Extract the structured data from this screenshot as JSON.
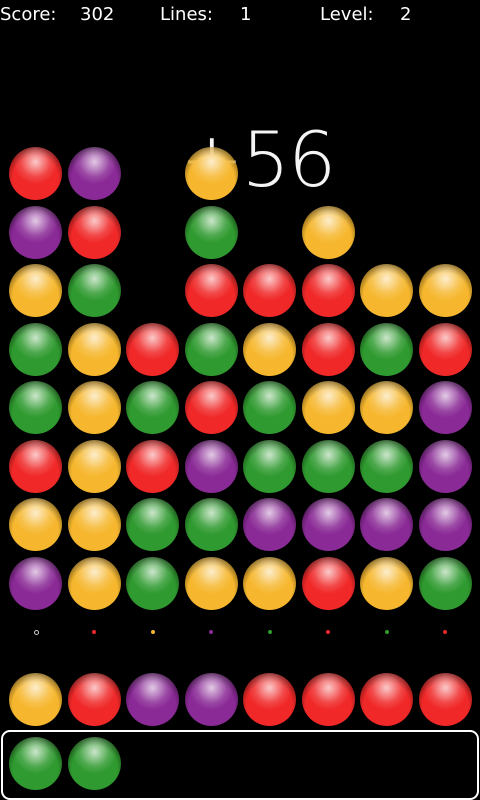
{
  "hud": {
    "score_label": "Score:",
    "score_value": "302",
    "lines_label": "Lines:",
    "lines_value": "1",
    "level_label": "Level:",
    "level_value": "2"
  },
  "popup": {
    "text": "+56"
  },
  "colors": {
    "red": "#f02828",
    "purple": "#8a2a96",
    "yellow": "#f6b72e",
    "green": "#2f9a2f"
  },
  "grid": [
    [
      "red",
      "purple",
      "",
      "",
      "",
      "",
      "",
      ""
    ],
    [
      "purple",
      "red",
      "",
      "green",
      "",
      "yellow",
      "",
      ""
    ],
    [
      "yellow",
      "green",
      "",
      "red",
      "red",
      "red",
      "yellow",
      "yellow"
    ],
    [
      "green",
      "yellow",
      "red",
      "green",
      "yellow",
      "red",
      "green",
      "red"
    ],
    [
      "green",
      "yellow",
      "green",
      "red",
      "green",
      "yellow",
      "yellow",
      "purple"
    ],
    [
      "red",
      "yellow",
      "red",
      "purple",
      "green",
      "green",
      "green",
      "purple"
    ],
    [
      "yellow",
      "yellow",
      "green",
      "green",
      "purple",
      "purple",
      "purple",
      "purple"
    ],
    [
      "purple",
      "yellow",
      "green",
      "yellow",
      "yellow",
      "red",
      "yellow",
      "green"
    ]
  ],
  "falling_ball": "yellow",
  "column_markers": [
    "hollow",
    "red",
    "yellow",
    "purple",
    "green",
    "red",
    "green",
    "red"
  ],
  "incoming_row": [
    "yellow",
    "red",
    "purple",
    "purple",
    "red",
    "red",
    "red",
    "red"
  ],
  "tray_balls": [
    "green",
    "green"
  ]
}
